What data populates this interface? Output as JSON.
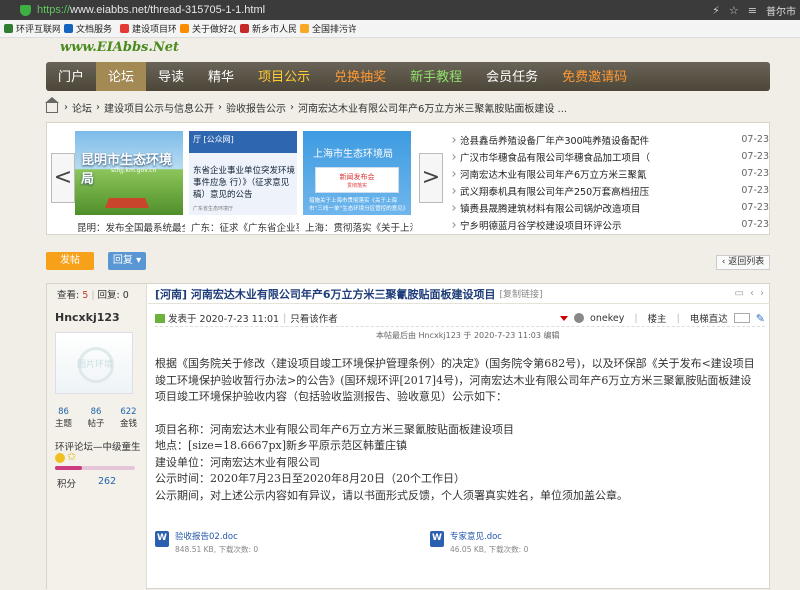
{
  "browser": {
    "url_scheme": "https://",
    "url_rest": "www.eiabbs.net/thread-315705-1-1.html",
    "user": "普尔市"
  },
  "bookmarks": [
    {
      "label": "环评互联网",
      "color": "#2e7d32"
    },
    {
      "label": "文档服务",
      "color": "#1565c0"
    },
    {
      "label": "建设项目环",
      "color": "#e53935"
    },
    {
      "label": "关于做好2(",
      "color": "#fb8c00"
    },
    {
      "label": "新乡市人民",
      "color": "#c62828"
    },
    {
      "label": "全国排污许",
      "color": "#f9a825"
    }
  ],
  "site": {
    "logo": "www.EIAbbs.Net"
  },
  "nav": [
    {
      "label": "门户",
      "style": "normal"
    },
    {
      "label": "论坛",
      "style": "active"
    },
    {
      "label": "导读",
      "style": "normal"
    },
    {
      "label": "精华",
      "style": "normal"
    },
    {
      "label": "项目公示",
      "style": "yellow"
    },
    {
      "label": "兑换抽奖",
      "style": "orange"
    },
    {
      "label": "新手教程",
      "style": "green"
    },
    {
      "label": "会员任务",
      "style": "normal"
    },
    {
      "label": "免费邀请码",
      "style": "orange"
    }
  ],
  "breadcrumb": {
    "sep": "›",
    "items": [
      "论坛",
      "建设项目公示与信息公开",
      "验收报告公示",
      "河南宏达木业有限公司年产6万立方米三聚氰胺贴面板建设 ..."
    ]
  },
  "slider": {
    "prev": "<",
    "next": ">",
    "thumbs": [
      {
        "title": "昆明市生态环境局",
        "sub": "sthjj.km.gov.cn",
        "caption": "昆明：发布全国最系统最全"
      },
      {
        "band": "厅 [公众网]",
        "text": "东省企业事业单位突发环境事件应急 行）》（征求意见稿）意见的公告",
        "foot": "广东省生态环境厅",
        "caption": "广东：征求《广东省企业事"
      },
      {
        "title": "上海市生态环境局",
        "box1": "新闻发布会",
        "box2": "贯彻落实",
        "foot": "措施关于上海市贯彻落实《关于上海市“三线一单”生态环境分区管控的意见》",
        "caption": "上海：贯彻落实《关于上海"
      }
    ]
  },
  "news": [
    {
      "title": "沧县鑫岳养殖设备厂年产300吨养殖设备配件",
      "date": "07-23"
    },
    {
      "title": "广汉市华穗食品有限公司华穗食品加工项目（",
      "date": "07-23"
    },
    {
      "title": "河南宏达木业有限公司年产6万立方米三聚氰",
      "date": "07-23"
    },
    {
      "title": "武义翔泰机具有限公司年产250万套高档扭压",
      "date": "07-23"
    },
    {
      "title": "镇赉县晟腾建筑材料有限公司锅炉改造项目",
      "date": "07-23"
    },
    {
      "title": "宁乡明德蓝月谷学校建设项目环评公示",
      "date": "07-23"
    }
  ],
  "actions": {
    "post": "发帖",
    "reply": "回复",
    "back": "‹ 返回列表"
  },
  "thread": {
    "views_label": "查看:",
    "views": "5",
    "replies_label": "回复:",
    "replies": "0",
    "title": "[河南] 河南宏达木业有限公司年产6万立方米三聚氰胺贴面板建设项目",
    "copy_link": "[复制链接]"
  },
  "author": {
    "name": "Hncxkj123",
    "avatar_watermark": "图片环境",
    "stats": [
      {
        "v": "86",
        "l": "主题"
      },
      {
        "v": "86",
        "l": "帖子"
      },
      {
        "v": "622",
        "l": "金钱"
      }
    ],
    "level": "环评论坛—中级童生",
    "level_progress": 0.34,
    "points_label": "积分",
    "points": "262"
  },
  "post": {
    "date": "发表于 2020-7-23 11:01",
    "only_author": "只看该作者",
    "onekey": "onekey",
    "floor": "楼主",
    "jump": "电梯直达",
    "edited": "本帖最后由 Hncxkj123 于 2020-7-23 11:03 编辑",
    "p1": "根据《国务院关于修改〈建设项目竣工环境保护管理条例〉的决定》(国务院令第682号)，以及环保部《关于发布<建设项目竣工环境保护验收暂行办法>的公告》(国环规环评[2017]4号)，河南宏达木业有限公司年产6万立方米三聚氰胺贴面板建设项目竣工环境保护验收内容（包括验收监测报告、验收意见）公示如下：",
    "lines": [
      "项目名称：河南宏达木业有限公司年产6万立方米三聚氰胺贴面板建设项目",
      "地点：[size=18.6667px]新乡平原示范区韩董庄镇",
      "建设单位：河南宏达木业有限公司",
      "公示时间：2020年7月23日至2020年8月20日（20个工作日）",
      "公示期间，对上述公示内容如有异议，请以书面形式反馈，个人须署真实姓名，单位须加盖公章。"
    ]
  },
  "attachments": [
    {
      "name": "验收报告02.doc",
      "size": "848.51 KB, 下载次数: 0"
    },
    {
      "name": "专家意见.doc",
      "size": "46.05 KB, 下载次数: 0"
    }
  ]
}
